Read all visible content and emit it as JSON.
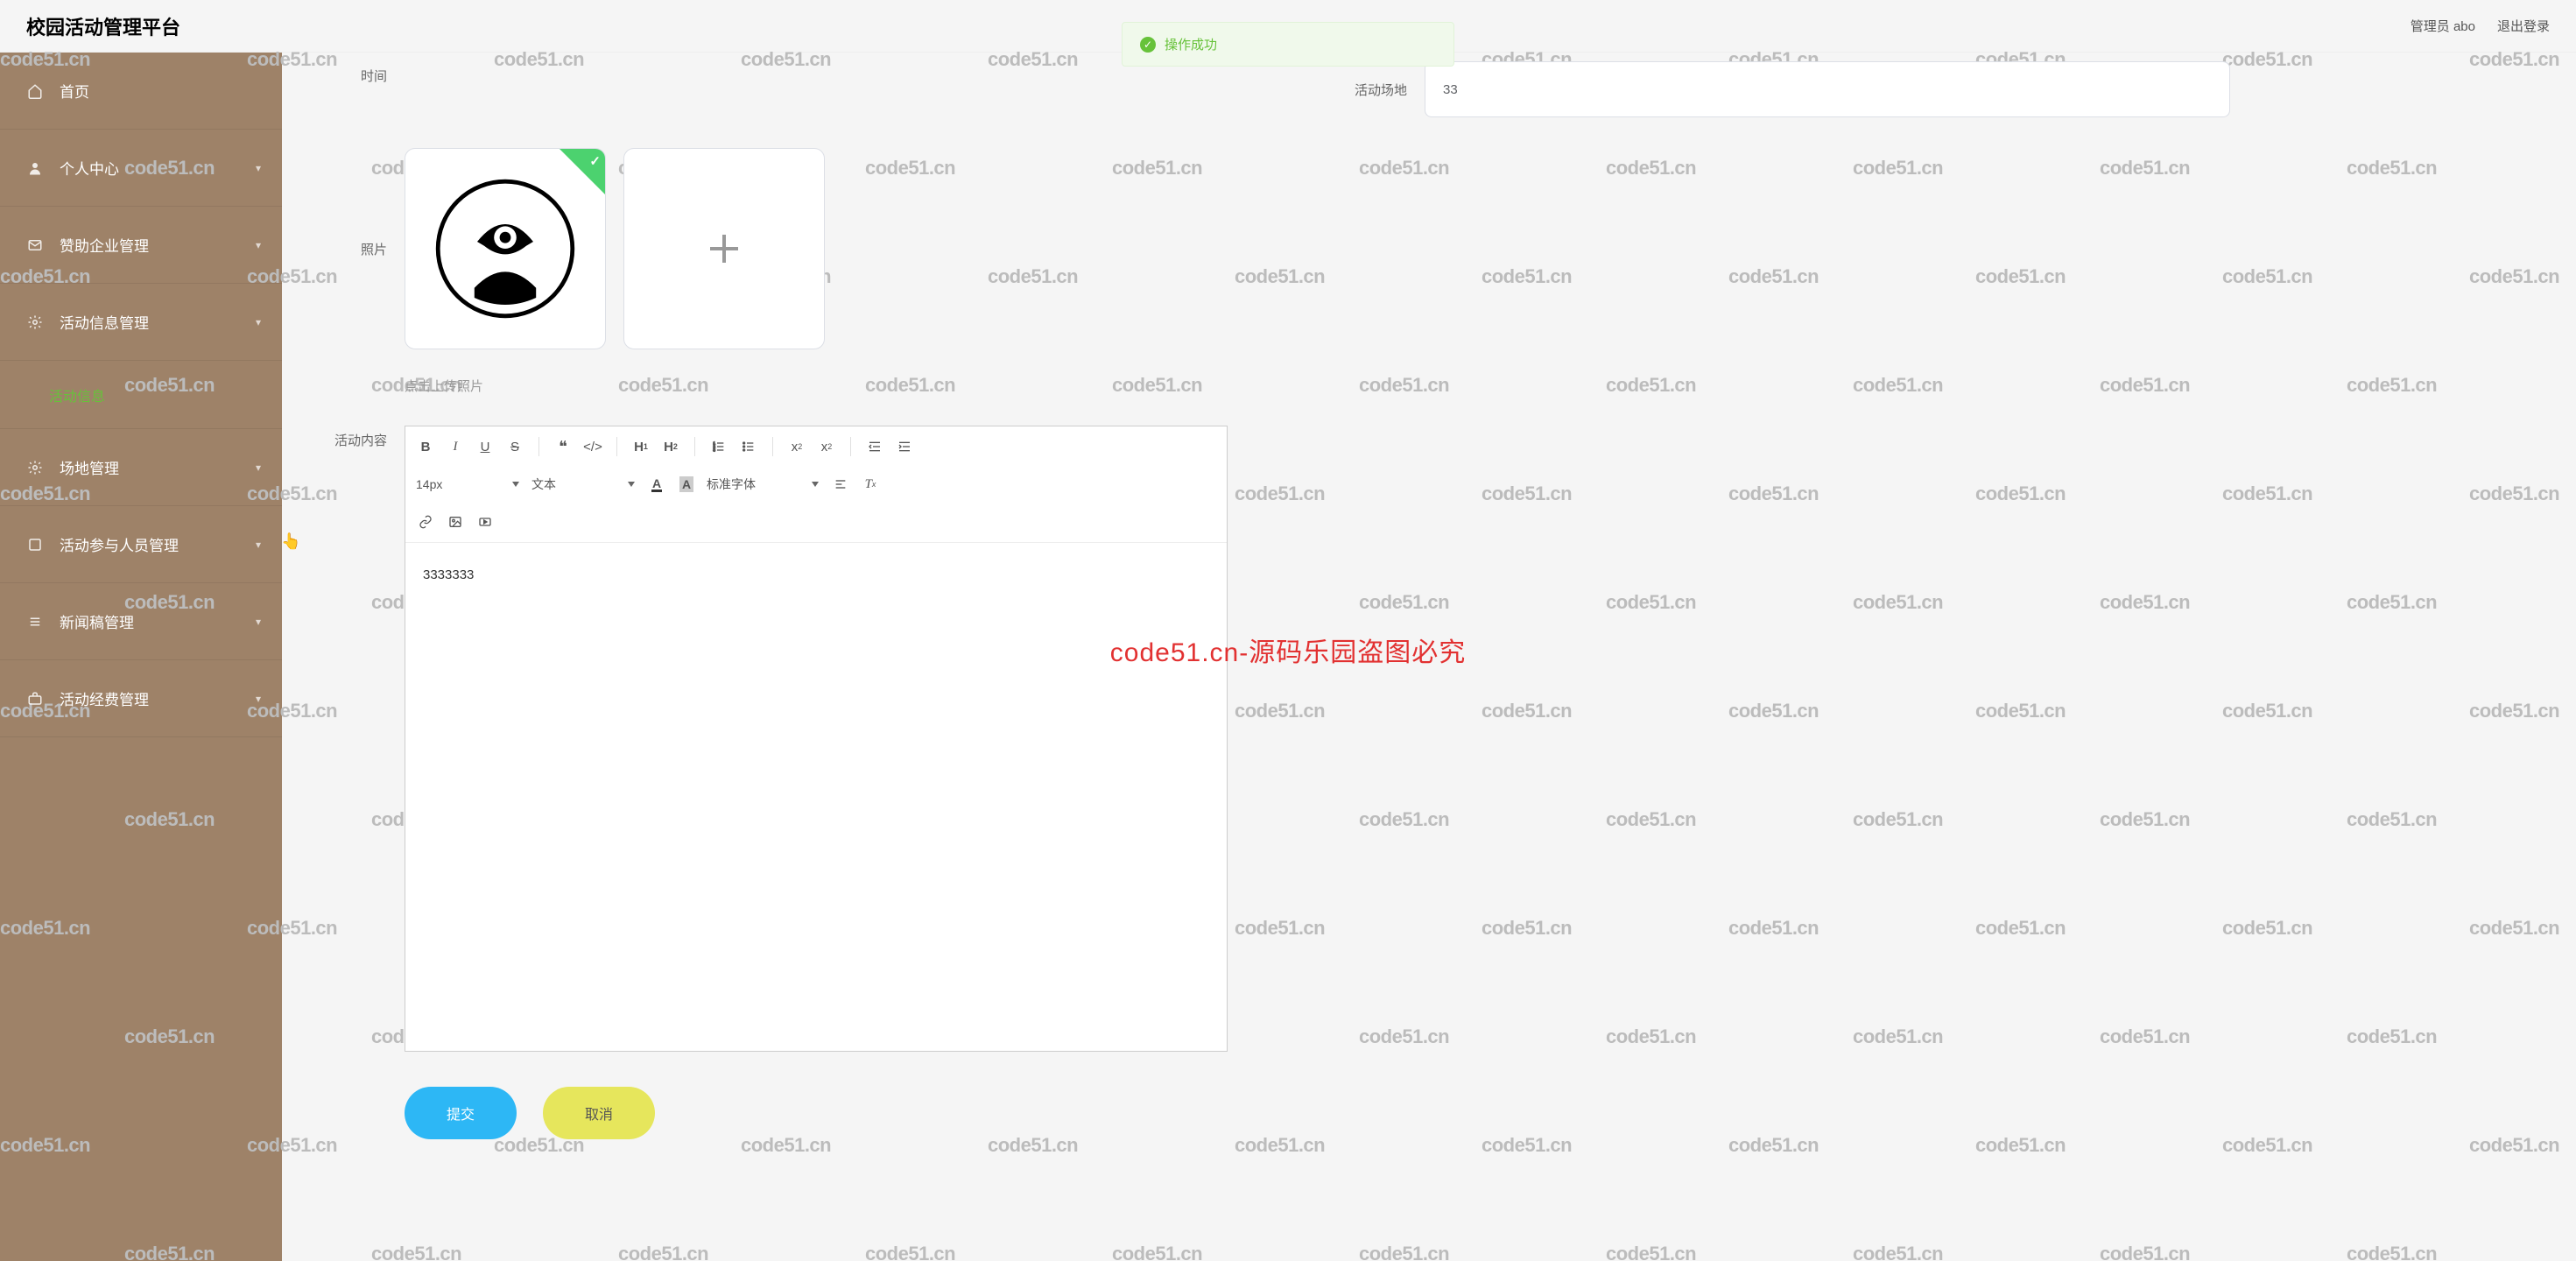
{
  "header": {
    "title": "校园活动管理平台",
    "admin_label": "管理员 abo",
    "logout": "退出登录"
  },
  "toast": {
    "text": "操作成功"
  },
  "sidebar": {
    "items": [
      {
        "label": "首页",
        "icon": "home-icon",
        "expandable": false
      },
      {
        "label": "个人中心",
        "icon": "user-icon",
        "expandable": true
      },
      {
        "label": "赞助企业管理",
        "icon": "mail-icon",
        "expandable": true
      },
      {
        "label": "活动信息管理",
        "icon": "gear-icon",
        "expandable": true,
        "sub": [
          {
            "label": "活动信息"
          }
        ]
      },
      {
        "label": "场地管理",
        "icon": "gear-icon",
        "expandable": true
      },
      {
        "label": "活动参与人员管理",
        "icon": "list-icon",
        "expandable": true
      },
      {
        "label": "新闻稿管理",
        "icon": "list-icon",
        "expandable": true
      },
      {
        "label": "活动经费管理",
        "icon": "briefcase-icon",
        "expandable": true
      }
    ]
  },
  "form": {
    "time_label": "时间",
    "venue_label": "活动场地",
    "venue_value": "33",
    "photo_label": "照片",
    "upload_hint": "点击上传照片",
    "content_label": "活动内容",
    "editor_text": "3333333",
    "font_size": "14px",
    "block_type": "文本",
    "font_family": "标准字体",
    "submit": "提交",
    "cancel": "取消"
  },
  "watermark": {
    "text": "code51.cn",
    "red": "code51.cn-源码乐园盗图必究"
  }
}
